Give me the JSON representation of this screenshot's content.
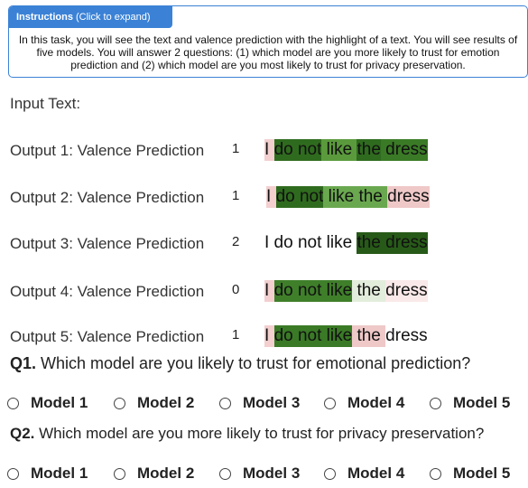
{
  "instructions": {
    "header_bold": "Instructions",
    "header_rest": " (Click to expand)",
    "body": "In this task, you will see the text and valence prediction with the highlight of a text. You will see results of five models. You will answer 2 questions: (1) which model are you more likely to trust for emotion prediction and (2) which model are you most likely to trust for privacy preservation."
  },
  "input_label": "Input Text:",
  "outputs": [
    {
      "label": "Output 1: Valence Prediction",
      "value": "1",
      "tokens": [
        {
          "text": "I ",
          "color": "#f3cfcf"
        },
        {
          "text": "do not",
          "color": "#2f6b1e"
        },
        {
          "text": " like ",
          "color": "#5a9a3c"
        },
        {
          "text": "the",
          "color": "#2f6b1e"
        },
        {
          "text": " dress",
          "color": "#3a7a26"
        }
      ]
    },
    {
      "label": "Output 2: Valence Prediction",
      "value": "1",
      "tokens": [
        {
          "text": "I ",
          "color": "#f3cfcf"
        },
        {
          "text": "do not",
          "color": "#2f6b1e"
        },
        {
          "text": " like the ",
          "color": "#6aa84f"
        },
        {
          "text": "dress",
          "color": "#efc8c8"
        }
      ]
    },
    {
      "label": "Output 3: Valence Prediction",
      "value": "2",
      "tokens": [
        {
          "text": "I do not like ",
          "color": "#ffffff"
        },
        {
          "text": "the dress",
          "color": "#275a18"
        }
      ]
    },
    {
      "label": "Output 4: Valence Prediction",
      "value": "0",
      "tokens": [
        {
          "text": "I ",
          "color": "#f3cfcf"
        },
        {
          "text": "do not like",
          "color": "#3f7f2a"
        },
        {
          "text": " the ",
          "color": "#e3eddc"
        },
        {
          "text": "dress",
          "color": "#fae9e9"
        }
      ]
    },
    {
      "label": "Output 5: Valence Prediction",
      "value": "1",
      "tokens": [
        {
          "text": "I ",
          "color": "#f3cfcf"
        },
        {
          "text": "do not like",
          "color": "#3a7a26"
        },
        {
          "text": " the ",
          "color": "#efc8c8"
        },
        {
          "text": "dress",
          "color": "#ffffff"
        }
      ]
    }
  ],
  "questions": [
    {
      "number": "Q1.",
      "text": " Which model are you likely to trust for emotional prediction?",
      "options": [
        "Model 1",
        "Model 2",
        "Model 3",
        "Model 4",
        "Model 5"
      ]
    },
    {
      "number": "Q2.",
      "text": " Which model are you more likely to trust for privacy preservation?",
      "options": [
        "Model 1",
        "Model 2",
        "Model 3",
        "Model 4",
        "Model 5"
      ]
    }
  ]
}
